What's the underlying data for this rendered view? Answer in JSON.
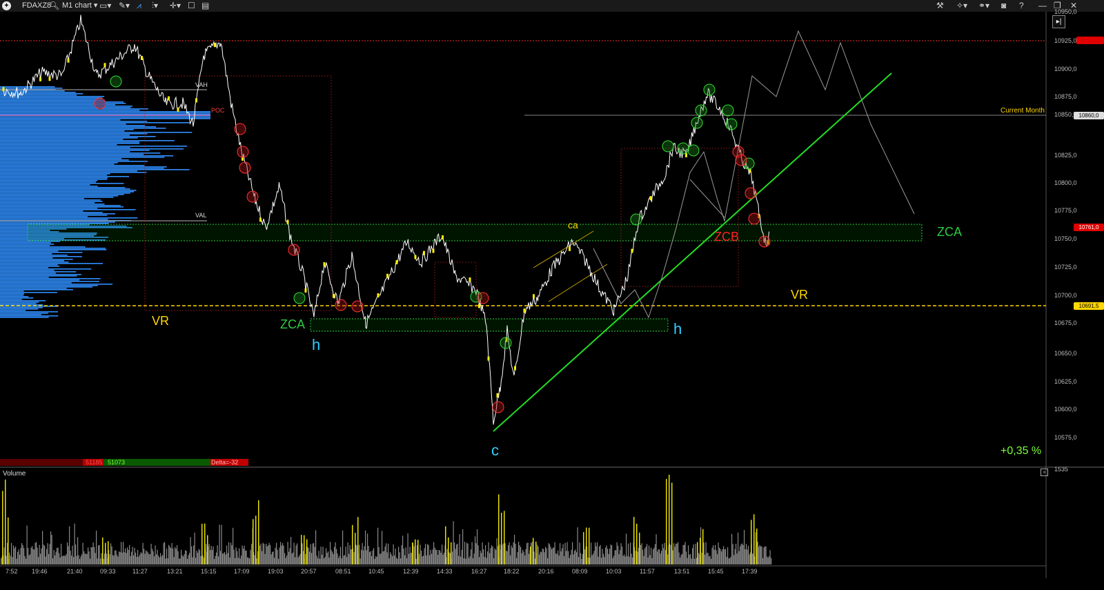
{
  "toolbar": {
    "symbol": "FDAXZ8",
    "chart_type": "M1 chart"
  },
  "chart": {
    "price_axis": [
      "10950,0",
      "10925,0",
      "10900,0",
      "10875,0",
      "10850,0",
      "10825,0",
      "10800,0",
      "10775,0",
      "10750,0",
      "10725,0",
      "10700,0",
      "10675,0",
      "10650,0",
      "10625,0",
      "10600,0",
      "10575,0"
    ],
    "time_axis": [
      "7:52",
      "19:46",
      "21:40",
      "09:33",
      "11:27",
      "13:21",
      "15:15",
      "17:09",
      "19:03",
      "20:57",
      "08:51",
      "10:45",
      "12:39",
      "14:33",
      "16:27",
      "18:22",
      "20:16",
      "08:09",
      "10:03",
      "11:57",
      "13:51",
      "15:45",
      "17:39"
    ],
    "current_price_tag": "10761,0",
    "vr_price_tag": "10691,5",
    "resistance_tag": "",
    "current_month_tag": "10860,0",
    "current_month_label": "Current Month",
    "annotations": {
      "vr_left": "VR",
      "vr_right": "VR",
      "zca_left": "ZCA",
      "zca_right": "ZCA",
      "zcb": "ZCB",
      "h_left": "h",
      "h_right": "h",
      "c": "c",
      "ca": "ca",
      "val": "VAL",
      "vah": "VAH",
      "poc": "POC"
    },
    "change_pct": "+0,35 %",
    "delta_bar": {
      "sell": "51185",
      "buy": "51073",
      "delta": "Delta=-32"
    },
    "colors": {
      "price_line": "#ffffff",
      "volume_highlight": "#ffff00",
      "zone_green": "#2ecc40",
      "vr_line": "#ffd700",
      "resistance": "#ff3030",
      "profile_blue": "#2f8fff"
    }
  },
  "volume_panel": {
    "title": "Volume",
    "axis_top": "1535"
  }
}
